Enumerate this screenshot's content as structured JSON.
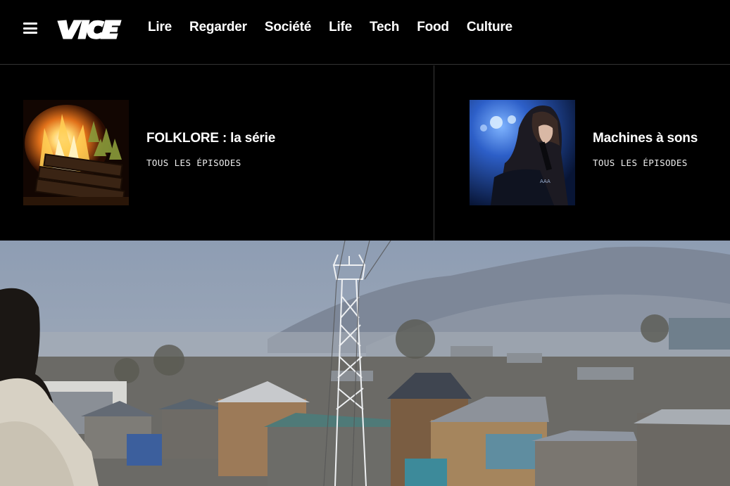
{
  "header": {
    "menu_icon": "hamburger-menu-icon",
    "logo_text": "VICE",
    "nav": [
      "Lire",
      "Regarder",
      "Société",
      "Life",
      "Tech",
      "Food",
      "Culture"
    ]
  },
  "series": [
    {
      "title": "FOLKLORE : la série",
      "link": "TOUS LES ÉPISODES",
      "image": "bonfire-thumbnail"
    },
    {
      "title": "Machines à sons",
      "link": "TOUS LES ÉPISODES",
      "image": "singer-thumbnail"
    }
  ],
  "hero": {
    "image": "kashmir-town-cable-car-photo"
  },
  "colors": {
    "background": "#000000",
    "text": "#ffffff",
    "divider": "#3a3a3a"
  }
}
